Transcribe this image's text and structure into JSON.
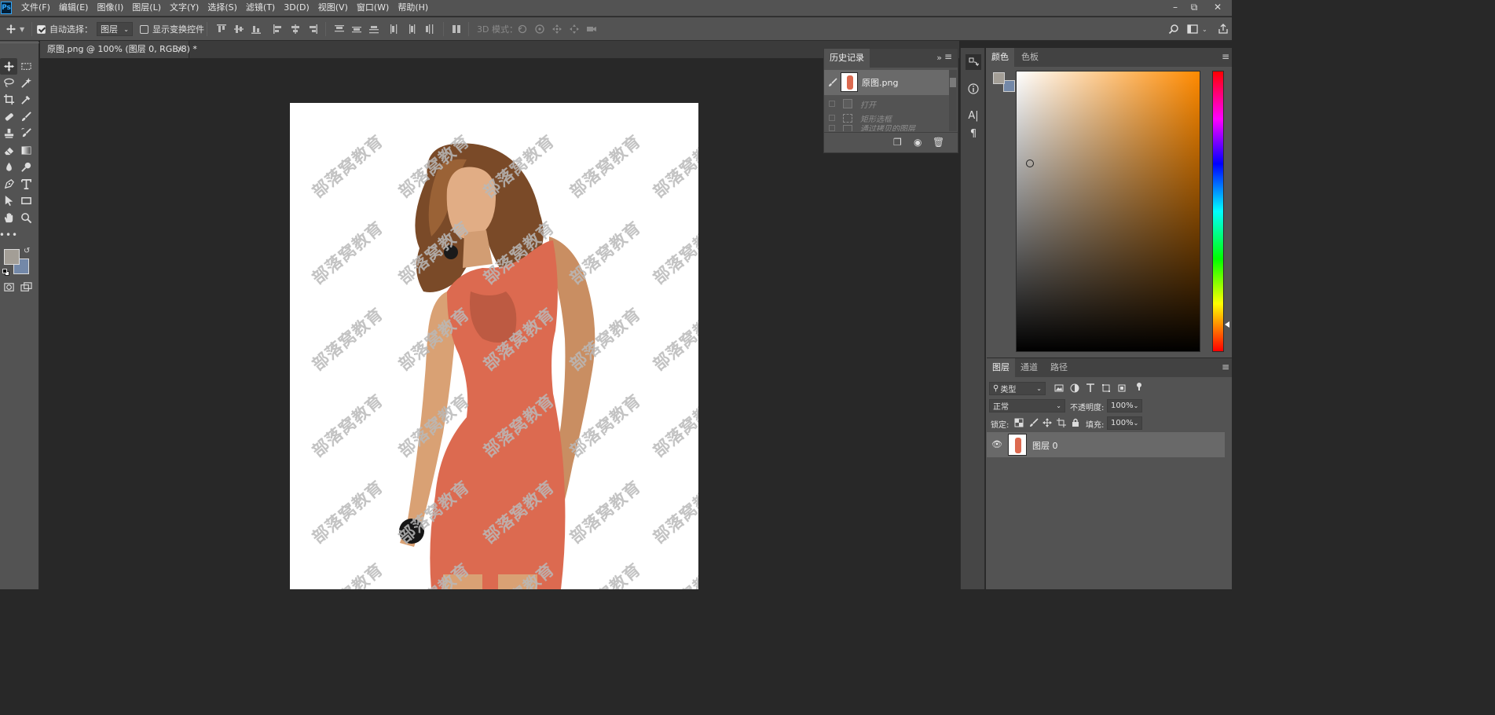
{
  "app": {
    "logo": "Ps",
    "menu": [
      "文件(F)",
      "编辑(E)",
      "图像(I)",
      "图层(L)",
      "文字(Y)",
      "选择(S)",
      "滤镜(T)",
      "3D(D)",
      "视图(V)",
      "窗口(W)",
      "帮助(H)"
    ],
    "window_controls": [
      "minimize-icon",
      "restore-icon",
      "close-icon"
    ]
  },
  "options_bar": {
    "auto_select_label": "自动选择：",
    "auto_select_checked": true,
    "auto_select_target": "图层",
    "transform_controls_label": "显示变换控件",
    "transform_controls_checked": false,
    "mode_3d_label": "3D 模式："
  },
  "document": {
    "tab_title": "原图.png @ 100% (图层 0, RGB/8) *",
    "watermark_text": "部落窝教育"
  },
  "history_panel": {
    "title": "历史记录",
    "snapshot_label": "原图.png",
    "states": [
      "打开",
      "矩形选框",
      "通过拷贝的图层"
    ]
  },
  "color_panel": {
    "tabs": [
      "颜色",
      "色板"
    ],
    "foreground": "#a39e96",
    "background": "#7388a8",
    "hue_color": "#ff8a00"
  },
  "layers_panel": {
    "tabs": [
      "图层",
      "通道",
      "路径"
    ],
    "filter_kind": "类型",
    "blend_mode": "正常",
    "opacity_label": "不透明度:",
    "opacity_value": "100%",
    "lock_label": "锁定:",
    "fill_label": "填充:",
    "fill_value": "100%",
    "layers": [
      {
        "name": "图层 0",
        "visible": true
      }
    ]
  }
}
